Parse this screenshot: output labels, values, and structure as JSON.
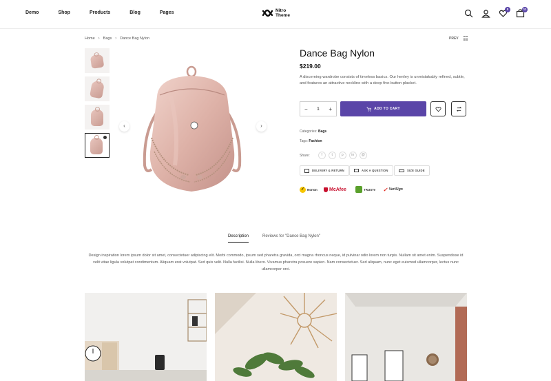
{
  "nav": {
    "items": [
      "Demo",
      "Shop",
      "Products",
      "Blog",
      "Pages"
    ],
    "logo_line1": "Nitro",
    "logo_line2": "Theme",
    "wishlist_count": "0",
    "cart_count": "11"
  },
  "breadcrumb": {
    "home": "Home",
    "category": "Bags",
    "current": "Dance Bag Nylon",
    "prev_label": "PREV"
  },
  "product": {
    "title": "Dance Bag Nylon",
    "price": "$219.00",
    "description": "A discerning wardrobe consists of timeless basics. Our henley is unmistakably refined, subtle, and features an attractive neckline with a deep five-button placket.",
    "quantity": "1",
    "add_to_cart": "ADD TO CART",
    "categories_label": "Categories:",
    "categories_value": "Bags",
    "tags_label": "Tags:",
    "tags_value": "Fashion",
    "share_label": "Share:",
    "delivery_label": "DELIVERY & RETURN",
    "question_label": "ASK A QUESTION",
    "size_label": "SIZE GUIDE",
    "trust": [
      "Norton",
      "McAfee",
      "TRUSTe",
      "VeriSign"
    ]
  },
  "tabs": {
    "description": "Description",
    "reviews": "Reviews for \"Dance Bag Nylon\"",
    "body": "Design inspiration lorem ipsum dolor sit amet, consectetuer adipiscing elit. Morbi commodo, ipsum sed pharetra gravida, orci magna rhoncus neque, id pulvinar odio lorem non turpis. Nullam sit amet enim. Suspendisse id velit vitae ligula volutpat condimentum. Aliquam erat volutpat. Sed quis velit. Nulla facilisi. Nulla libero. Vivamus pharetra posuere sapien. Nam consectetuer. Sed aliquam, nunc eget euismod ullamcorper, lectus nunc ullamcorper orci."
  },
  "colors": {
    "accent": "#5a45a8",
    "bag": "#d9aea5"
  }
}
